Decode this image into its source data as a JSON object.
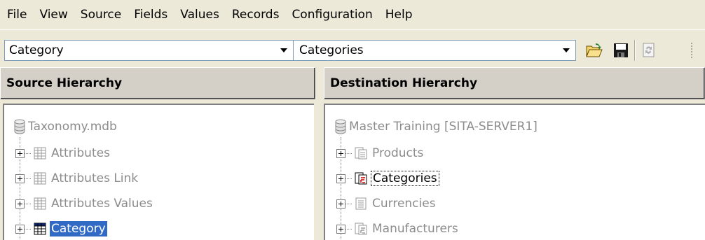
{
  "menubar": {
    "items": [
      "File",
      "View",
      "Source",
      "Fields",
      "Values",
      "Records",
      "Configuration",
      "Help"
    ]
  },
  "toolbar": {
    "source_combo": "Category",
    "dest_combo": "Categories",
    "buttons": [
      "open-folder-icon",
      "save-disk-icon",
      "refresh-icon"
    ]
  },
  "source": {
    "header": "Source Hierarchy",
    "root": "Taxonomy.mdb",
    "items": [
      {
        "label": "Attributes",
        "state": "dimmed"
      },
      {
        "label": "Attributes Link",
        "state": "dimmed"
      },
      {
        "label": "Attributes Values",
        "state": "dimmed"
      },
      {
        "label": "Category",
        "state": "selected"
      }
    ]
  },
  "destination": {
    "header": "Destination Hierarchy",
    "root": "Master Training [SITA-SERVER1]",
    "items": [
      {
        "label": "Products",
        "state": "dimmed"
      },
      {
        "label": "Categories",
        "state": "focused"
      },
      {
        "label": "Currencies",
        "state": "dimmed"
      },
      {
        "label": "Manufacturers",
        "state": "dimmed"
      }
    ]
  },
  "colors": {
    "selection": "#316ac5",
    "chrome": "#ece9d8",
    "header": "#d4d0c8",
    "dimmed_text": "#8c8c8c"
  }
}
